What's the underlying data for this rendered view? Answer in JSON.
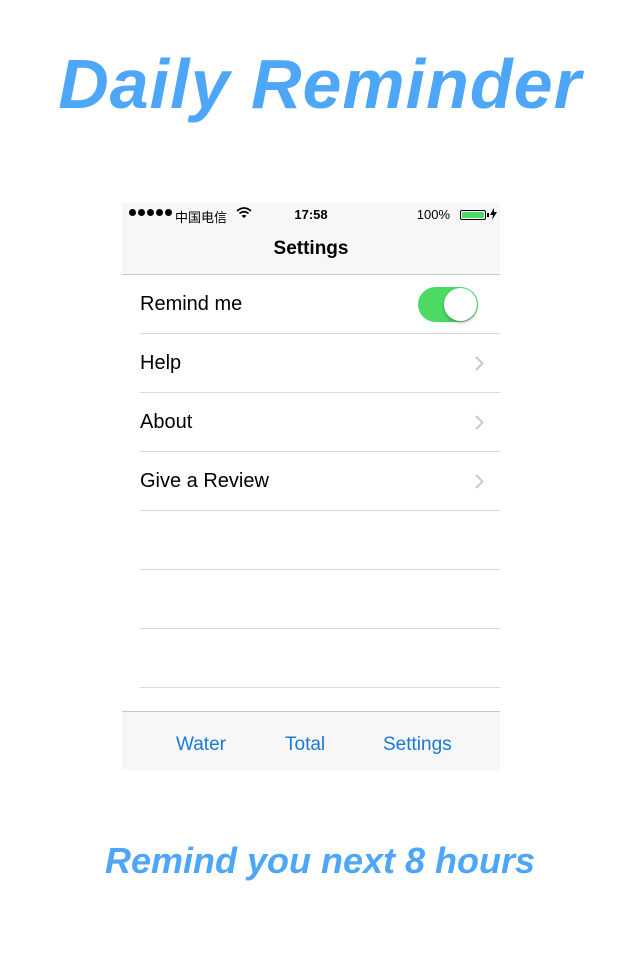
{
  "promo": {
    "headline": "Daily Reminder",
    "footline": "Remind you next 8 hours"
  },
  "status_bar": {
    "carrier": "中国电信",
    "time": "17:58",
    "battery": "100%"
  },
  "nav": {
    "title": "Settings"
  },
  "settings": {
    "rows": [
      {
        "label": "Remind me",
        "control": "toggle",
        "on": true
      },
      {
        "label": "Help",
        "control": "chevron"
      },
      {
        "label": "About",
        "control": "chevron"
      },
      {
        "label": "Give a Review",
        "control": "chevron"
      }
    ]
  },
  "tabs": {
    "water": "Water",
    "total": "Total",
    "settings": "Settings"
  },
  "colors": {
    "accent": "#4da6f7",
    "toggle_on": "#4cd964",
    "tab_text": "#1a78d6"
  },
  "icons": [
    "signal-dots-icon",
    "wifi-icon",
    "battery-icon",
    "charging-bolt-icon",
    "chevron-right-icon"
  ]
}
